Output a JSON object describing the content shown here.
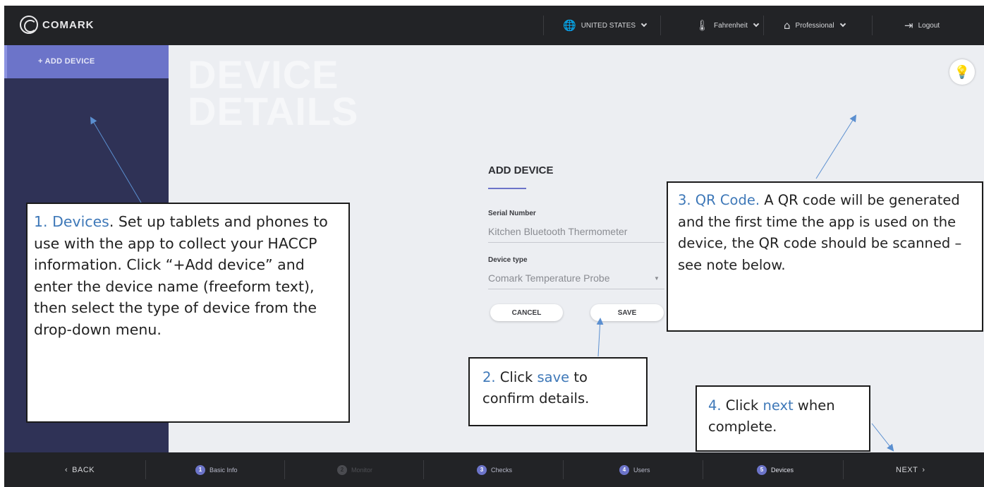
{
  "topbar": {
    "brand": "COMARK",
    "country": "UNITED STATES",
    "unit": "Fahrenheit",
    "plan": "Professional",
    "logout": "Logout"
  },
  "sidebar": {
    "add_device": "+ ADD DEVICE"
  },
  "main": {
    "bg_title_line1": "DEVICE",
    "bg_title_line2": "DETAILS"
  },
  "form": {
    "title": "ADD DEVICE",
    "serial_label": "Serial Number",
    "serial_value": "Kitchen Bluetooth Thermometer",
    "type_label": "Device type",
    "type_value": "Comark Temperature Probe",
    "cancel": "CANCEL",
    "save": "SAVE"
  },
  "bottombar": {
    "back": "BACK",
    "next": "NEXT",
    "steps": [
      {
        "num": "1",
        "label": "Basic Info",
        "state": "done"
      },
      {
        "num": "2",
        "label": "Monitor",
        "state": "disabled"
      },
      {
        "num": "3",
        "label": "Checks",
        "state": "done"
      },
      {
        "num": "4",
        "label": "Users",
        "state": "done"
      },
      {
        "num": "5",
        "label": "Devices",
        "state": "current"
      }
    ]
  },
  "callouts": {
    "c1_head": "1. Devices",
    "c1_body": ".  Set up tablets and phones to use with the app to collect your HACCP information. Click “+Add device” and enter the device name (freeform text), then select the type of device from the drop-down menu.",
    "c2_head": "2.",
    "c2_pre": " Click ",
    "c2_link": "save",
    "c2_post": " to confirm details.",
    "c3_head": "3. QR Code.",
    "c3_body": " A QR code will be generated and the first time the app is used on the device, the QR code should be scanned – see note below.",
    "c4_head": "4.",
    "c4_pre": " Click ",
    "c4_link": "next",
    "c4_post": " when complete."
  },
  "colors": {
    "accent": "#6c74c9",
    "sidebar": "#2f3256",
    "topbar": "#222326",
    "callout_accent": "#3e78b8"
  }
}
